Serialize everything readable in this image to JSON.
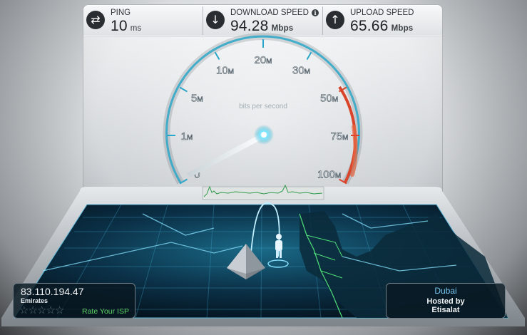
{
  "header": {
    "ping": {
      "label": "PING",
      "value": "10",
      "unit": "ms",
      "icon": "exchange-arrows-icon"
    },
    "download": {
      "label": "DOWNLOAD SPEED",
      "value": "94.28",
      "unit": "Mbps",
      "icon": "arrow-down-icon"
    },
    "upload": {
      "label": "UPLOAD SPEED",
      "value": "65.66",
      "unit": "Mbps",
      "icon": "arrow-up-icon"
    }
  },
  "gauge": {
    "caption": "bits per second",
    "ticks": [
      {
        "label": "0",
        "unit": ""
      },
      {
        "label": "1",
        "unit": "M"
      },
      {
        "label": "5",
        "unit": "M"
      },
      {
        "label": "10",
        "unit": "M"
      },
      {
        "label": "20",
        "unit": "M"
      },
      {
        "label": "30",
        "unit": "M"
      },
      {
        "label": "50",
        "unit": "M"
      },
      {
        "label": "75",
        "unit": "M"
      },
      {
        "label": "100",
        "unit": "M"
      }
    ],
    "needle_position_fraction": 0.18,
    "accent_color": "#2aa7c8",
    "redline_color": "#d9452a"
  },
  "isp": {
    "ip": "83.110.194.47",
    "name": "Emirates",
    "rating_stars": 5,
    "rating_filled": 0,
    "rate_label": "Rate Your ISP"
  },
  "server": {
    "city": "Dubai",
    "hosted_by_label": "Hosted by",
    "host": "Etisalat"
  }
}
